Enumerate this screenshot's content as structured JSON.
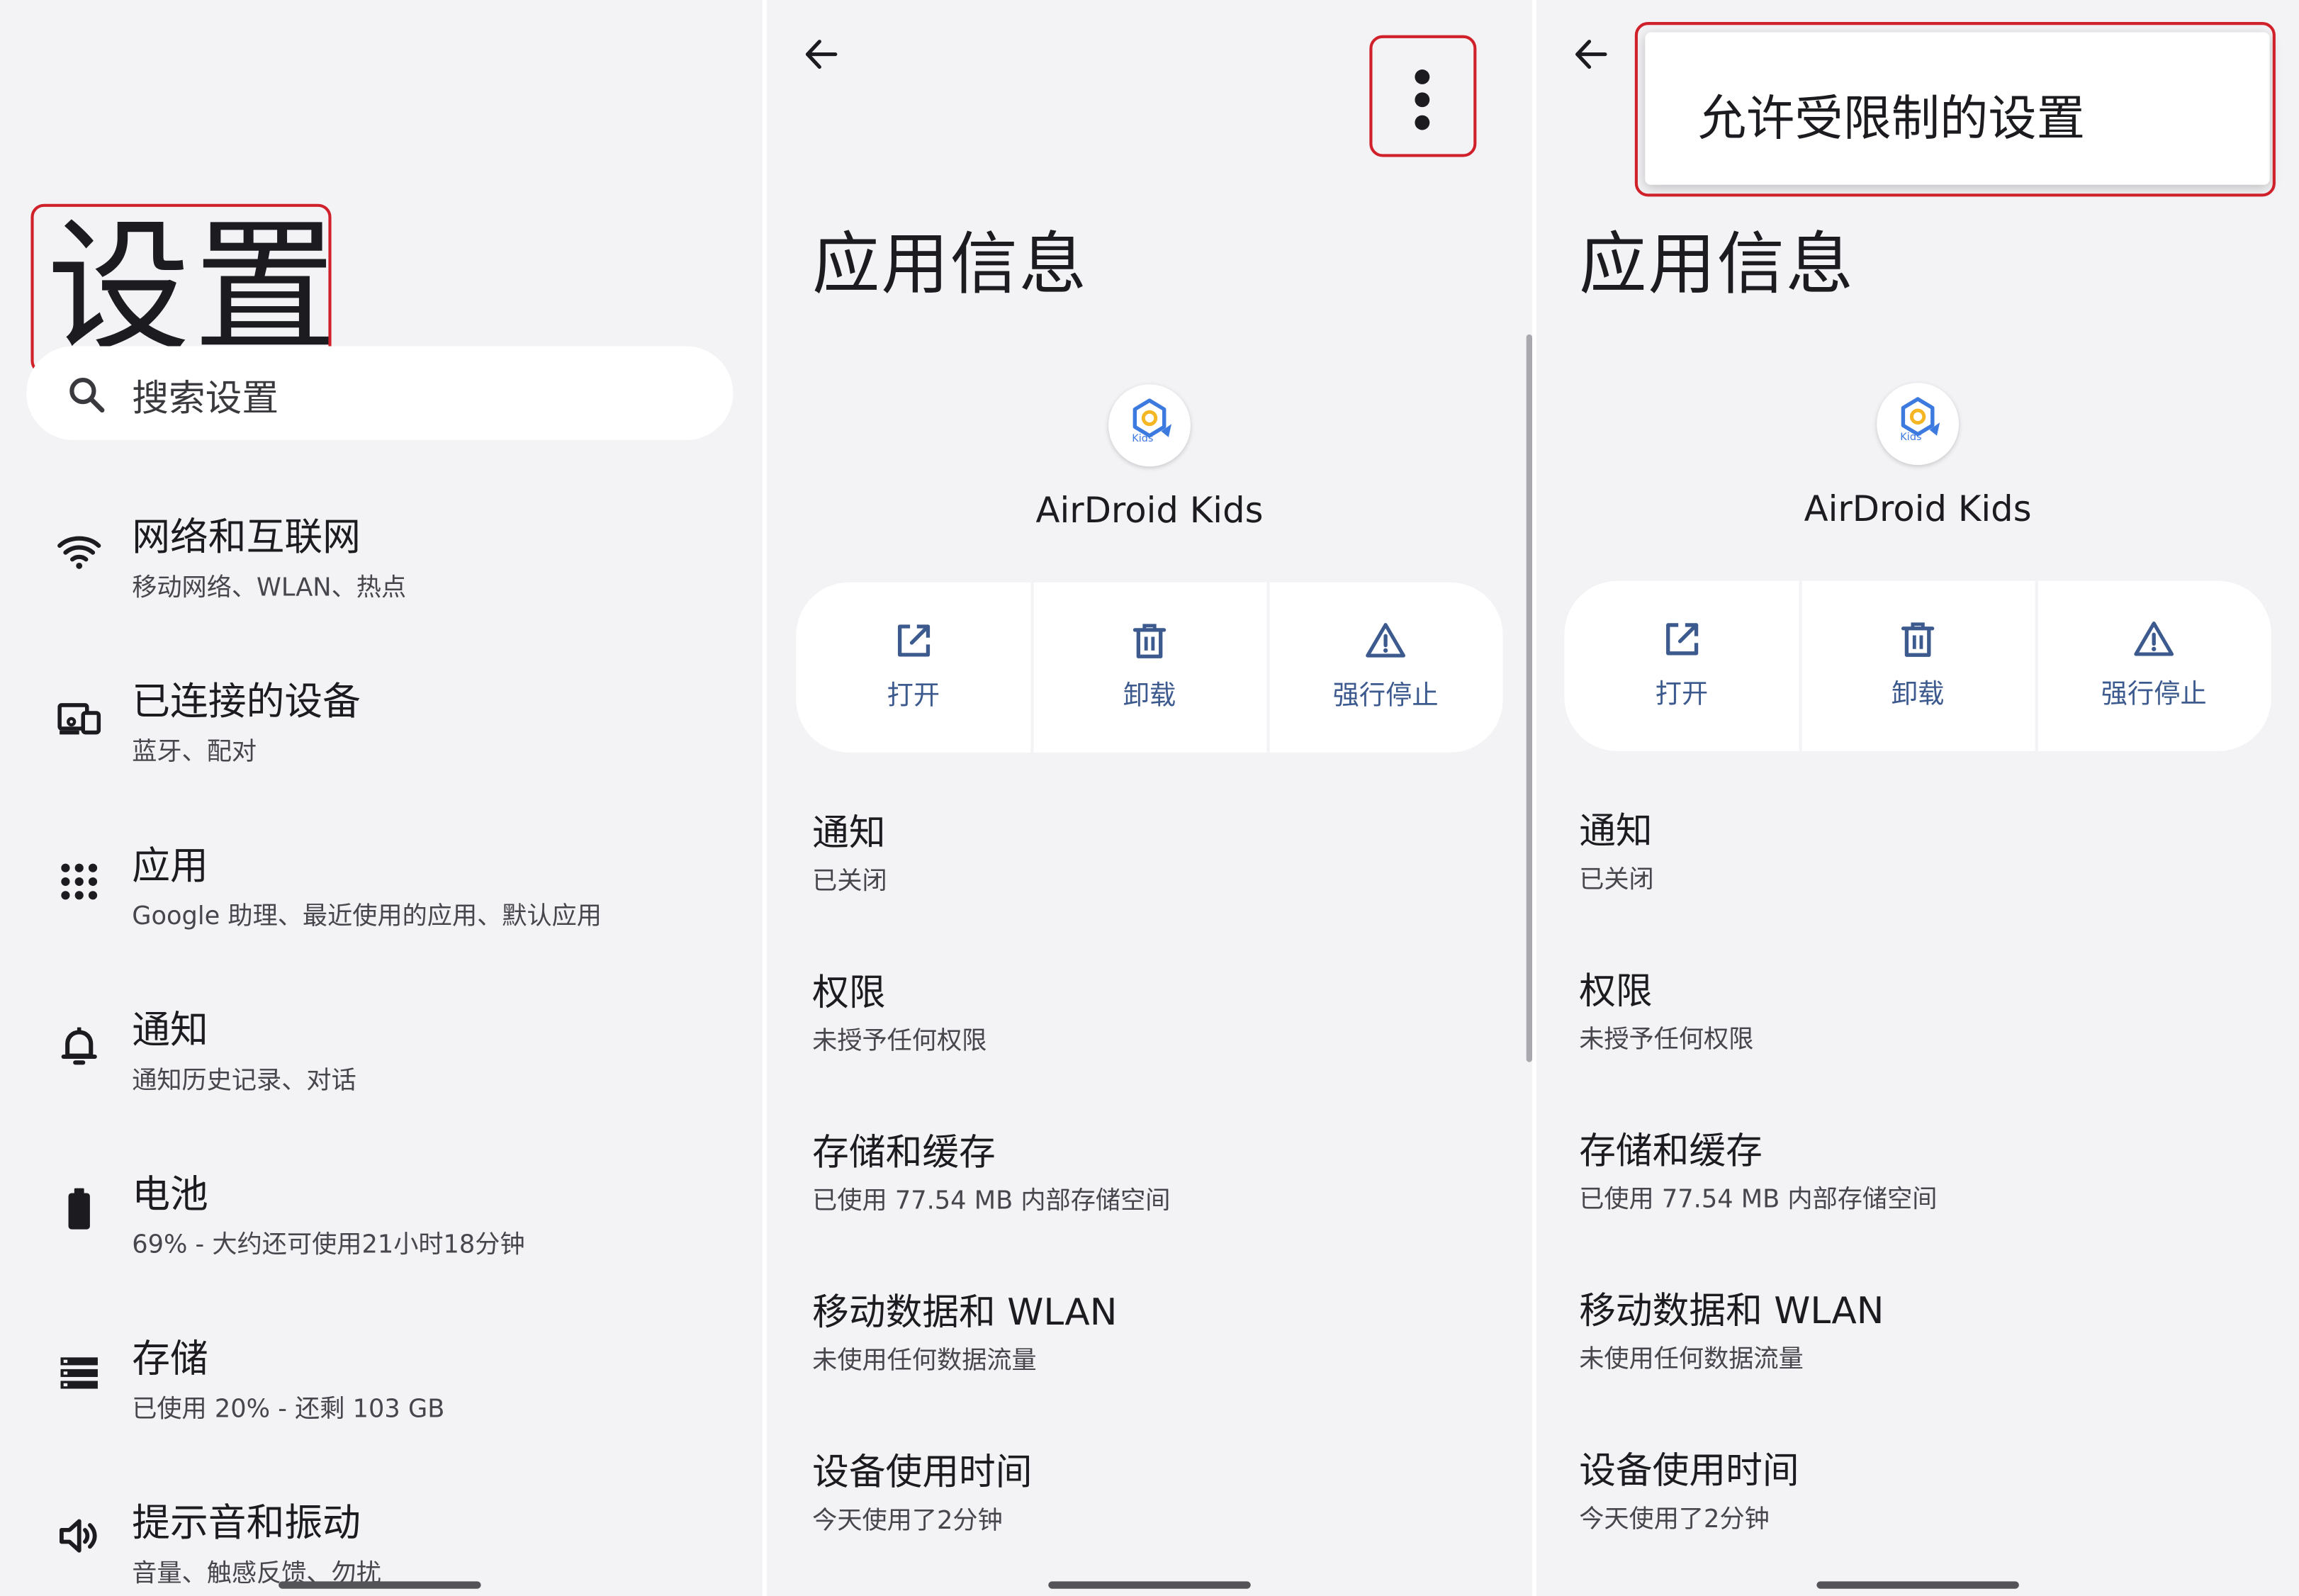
{
  "settings": {
    "title": "设置",
    "search_placeholder": "搜索设置",
    "items": [
      {
        "icon": "wifi-icon",
        "title": "网络和互联网",
        "subtitle": "移动网络、WLAN、热点"
      },
      {
        "icon": "devices-icon",
        "title": "已连接的设备",
        "subtitle": "蓝牙、配对"
      },
      {
        "icon": "apps-icon",
        "title": "应用",
        "subtitle": "Google 助理、最近使用的应用、默认应用"
      },
      {
        "icon": "bell-icon",
        "title": "通知",
        "subtitle": "通知历史记录、对话"
      },
      {
        "icon": "battery-icon",
        "title": "电池",
        "subtitle": "69% - 大约还可使用21小时18分钟"
      },
      {
        "icon": "storage-icon",
        "title": "存储",
        "subtitle": "已使用 20% - 还剩 103 GB"
      },
      {
        "icon": "volume-icon",
        "title": "提示音和振动",
        "subtitle": "音量、触感反馈、勿扰"
      }
    ]
  },
  "app_info": {
    "page_title": "应用信息",
    "app_name": "AirDroid Kids",
    "app_icon_text": "Kids",
    "actions": [
      {
        "icon": "open-external-icon",
        "label": "打开"
      },
      {
        "icon": "trash-icon",
        "label": "卸载"
      },
      {
        "icon": "warning-icon",
        "label": "强行停止"
      }
    ],
    "rows": [
      {
        "title": "通知",
        "subtitle": "已关闭"
      },
      {
        "title": "权限",
        "subtitle": "未授予任何权限"
      },
      {
        "title": "存储和缓存",
        "subtitle": "已使用 77.54 MB 内部存储空间"
      },
      {
        "title": "移动数据和 WLAN",
        "subtitle": "未使用任何数据流量"
      },
      {
        "title": "设备使用时间",
        "subtitle": "今天使用了2分钟"
      }
    ]
  },
  "overflow_menu": {
    "items": [
      "允许受限制的设置"
    ]
  },
  "colors": {
    "background": "#f3f2f5",
    "card": "#ffffff",
    "accent": "#3c5a8e",
    "highlight": "#d0202a"
  }
}
